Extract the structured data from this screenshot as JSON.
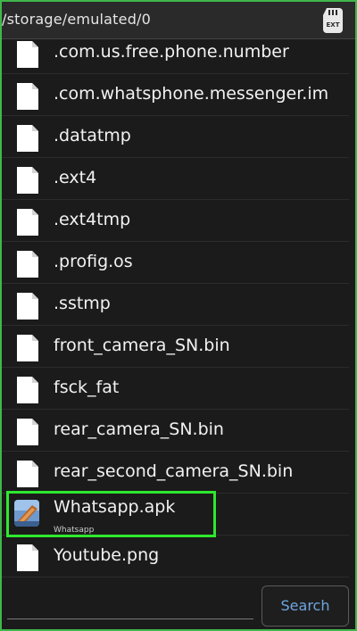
{
  "header": {
    "path": "/storage/emulated/0",
    "ext_icon_label": "EXT",
    "ext_icon": "sd-card-icon"
  },
  "files": [
    {
      "name": ".com.us.free.phone.number",
      "icon": "file-icon"
    },
    {
      "name": ".com.whatsphone.messenger.im",
      "icon": "file-icon"
    },
    {
      "name": ".datatmp",
      "icon": "file-icon"
    },
    {
      "name": ".ext4",
      "icon": "file-icon"
    },
    {
      "name": ".ext4tmp",
      "icon": "file-icon"
    },
    {
      "name": ".profig.os",
      "icon": "file-icon"
    },
    {
      "name": ".sstmp",
      "icon": "file-icon"
    },
    {
      "name": "front_camera_SN.bin",
      "icon": "file-icon"
    },
    {
      "name": "fsck_fat",
      "icon": "file-icon"
    },
    {
      "name": "rear_camera_SN.bin",
      "icon": "file-icon"
    },
    {
      "name": "rear_second_camera_SN.bin",
      "icon": "file-icon"
    },
    {
      "name": "Whatsapp.apk",
      "sub": "Whatsapp",
      "icon": "apk-icon"
    },
    {
      "name": "Youtube.png",
      "icon": "file-icon"
    }
  ],
  "search": {
    "value": "",
    "button_label": "Search"
  },
  "colors": {
    "highlight": "#2ee82e",
    "accent": "#6ea6e0",
    "background": "#1b1b1b"
  }
}
